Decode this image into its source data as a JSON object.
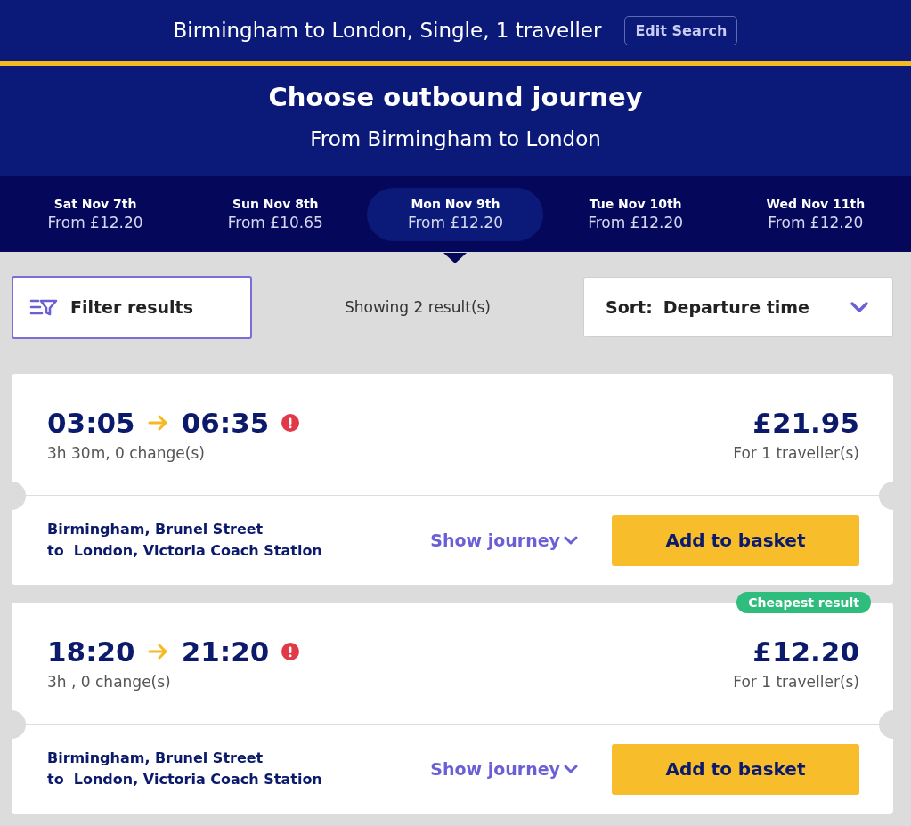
{
  "search_summary": {
    "text": "Birmingham to London, Single, 1 traveller",
    "edit_button": "Edit Search"
  },
  "header": {
    "title": "Choose outbound journey",
    "subtitle": "From Birmingham to London"
  },
  "dates": [
    {
      "day": "Sat Nov 7th",
      "price": "From £12.20",
      "selected": false
    },
    {
      "day": "Sun Nov 8th",
      "price": "From £10.65",
      "selected": false
    },
    {
      "day": "Mon Nov 9th",
      "price": "From £12.20",
      "selected": true
    },
    {
      "day": "Tue Nov 10th",
      "price": "From £12.20",
      "selected": false
    },
    {
      "day": "Wed Nov 11th",
      "price": "From £12.20",
      "selected": false
    }
  ],
  "toolbar": {
    "filter_button": "Filter results",
    "result_count": "Showing 2 result(s)",
    "sort_label": "Sort:",
    "sort_value": "Departure time"
  },
  "results": [
    {
      "depart": "03:05",
      "arrive": "06:35",
      "warning": true,
      "summary": "3h 30m, 0 change(s)",
      "price": "£21.95",
      "price_note": "For 1 traveller(s)",
      "route_from": "Birmingham, Brunel Street",
      "route_to": "to  London, Victoria Coach Station",
      "details_link": "Show journey",
      "button": "Add to basket"
    },
    {
      "badge": "Cheapest result",
      "depart": "18:20",
      "arrive": "21:20",
      "warning": true,
      "summary": "3h , 0 change(s)",
      "price": "£12.20",
      "price_note": "For 1 traveller(s)",
      "route_from": "Birmingham, Brunel Street",
      "route_to": "to  London, Victoria Coach Station",
      "details_link": "Show journey",
      "button": "Add to basket"
    }
  ]
}
